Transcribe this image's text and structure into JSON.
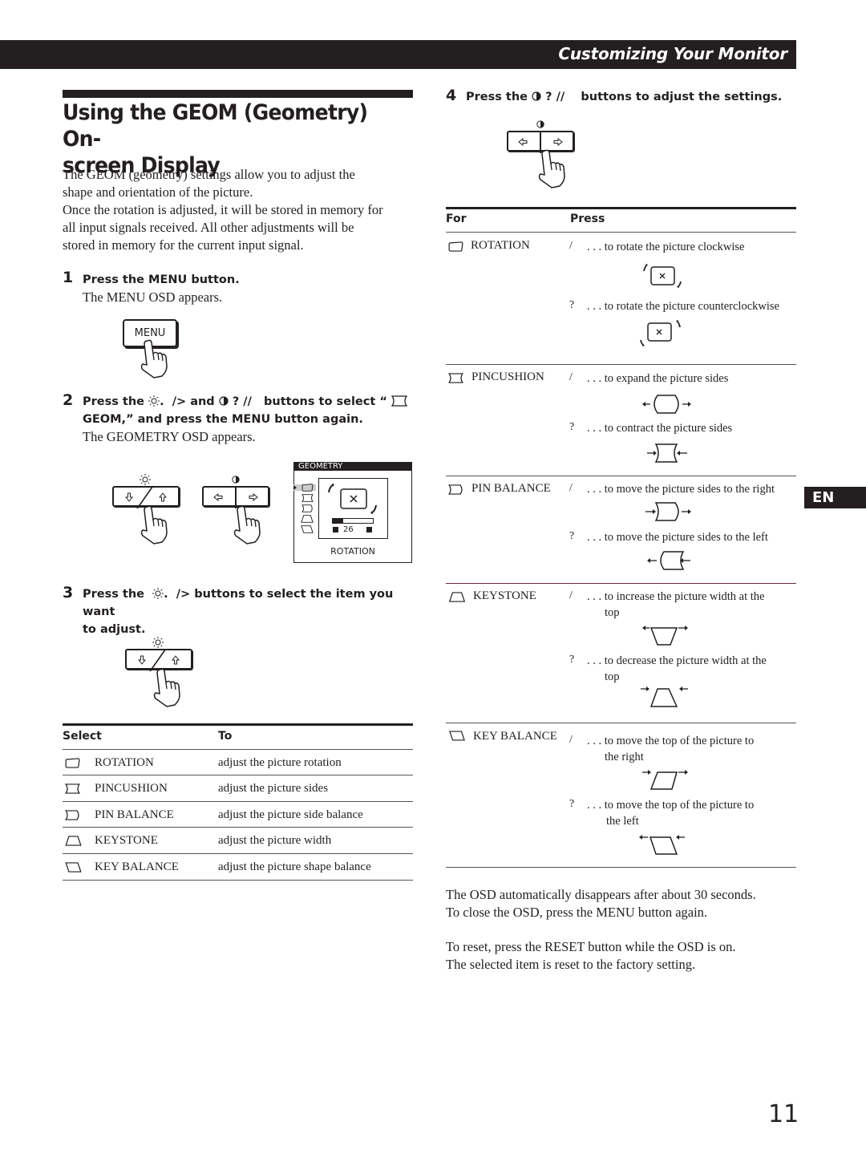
{
  "header": {
    "section_title": "Customizing Your Monitor"
  },
  "page": {
    "title_line1": "Using the GEOM (Geometry) On-",
    "title_line2": "screen Display",
    "language_tab": "EN",
    "page_number": "11"
  },
  "intro": {
    "lines": [
      "The GEOM (geometry) settings allow you to adjust the",
      "shape and orientation of the picture.",
      "Once the rotation is adjusted, it will be stored in memory for",
      "all input signals received. All other adjustments will be",
      "stored in memory for the current input signal."
    ]
  },
  "steps": [
    {
      "number": "1",
      "heading": "Press the MENU button.",
      "detail": "The MENU OSD appears.",
      "button_label": "MENU"
    },
    {
      "number": "2",
      "heading_part1": "Press the",
      "heading_part2": "/> and",
      "heading_part3": "? //",
      "heading_part4": "buttons to select “",
      "heading_line2": "GEOM,” and press the MENU button again.",
      "detail": "The GEOMETRY OSD appears."
    },
    {
      "number": "3",
      "heading_part1": "Press the",
      "heading_part2": "/>",
      "heading_part3": "buttons to select the item you want",
      "heading_line2": "to adjust."
    },
    {
      "number": "4",
      "heading_part1": "Press the",
      "heading_part2": "? //",
      "heading_part3": "buttons to adjust the settings."
    }
  ],
  "osd": {
    "title": "GEOMETRY",
    "selected_item": "ROTATION",
    "value": "26",
    "value_fraction": 0.26,
    "items": [
      "rotation-icon",
      "pincushion-icon",
      "pin-balance-icon",
      "keystone-icon",
      "key-balance-icon"
    ]
  },
  "select_table": {
    "headers": [
      "Select",
      "To"
    ],
    "rows": [
      {
        "icon": "rotation-icon",
        "item": "ROTATION",
        "action": "adjust the picture rotation"
      },
      {
        "icon": "pincushion-icon",
        "item": "PINCUSHION",
        "action": "adjust the picture sides"
      },
      {
        "icon": "pin-balance-icon",
        "item": "PIN BALANCE",
        "action": "adjust the picture side balance"
      },
      {
        "icon": "keystone-icon",
        "item": "KEYSTONE",
        "action": "adjust the picture width"
      },
      {
        "icon": "key-balance-icon",
        "item": "KEY BALANCE",
        "action": "adjust the picture shape balance"
      }
    ]
  },
  "press_table": {
    "headers": [
      "For",
      "Press"
    ],
    "rows": [
      {
        "icon": "rotation-icon",
        "item": "ROTATION",
        "options": [
          {
            "key": "/",
            "text": ". . . to rotate the picture clockwise"
          },
          {
            "key": "?",
            "text": ". . . to rotate the picture counterclockwise"
          }
        ]
      },
      {
        "icon": "pincushion-icon",
        "item": "PINCUSHION",
        "options": [
          {
            "key": "/",
            "text": ". . . to expand the picture sides"
          },
          {
            "key": "?",
            "text": ". . . to contract the picture sides"
          }
        ]
      },
      {
        "icon": "pin-balance-icon",
        "item": "PIN BALANCE",
        "options": [
          {
            "key": "/",
            "text": ". . . to move the picture sides to the right"
          },
          {
            "key": "?",
            "text": ". . . to move the picture sides to the left"
          }
        ]
      },
      {
        "icon": "keystone-icon",
        "item": "KEYSTONE",
        "options": [
          {
            "key": "/",
            "text": ". . . to increase the picture width at the",
            "text2": "top"
          },
          {
            "key": "?",
            "text": ". . . to decrease the picture width at the",
            "text2": "top"
          }
        ]
      },
      {
        "icon": "key-balance-icon",
        "item": "KEY BALANCE",
        "options": [
          {
            "key": "/",
            "text": ". . . to move the top of  the picture to",
            "text2": "the right"
          },
          {
            "key": "?",
            "text": ". . . to move the top of  the picture to",
            "text2": "the left"
          }
        ]
      }
    ]
  },
  "notes": {
    "line1": "The OSD automatically disappears after about 30 seconds.",
    "line2": "To close the OSD, press the MENU button again.",
    "line3": "To reset,  press the RESET button while the OSD is on.",
    "line4": "The selected item is reset to the factory setting."
  }
}
